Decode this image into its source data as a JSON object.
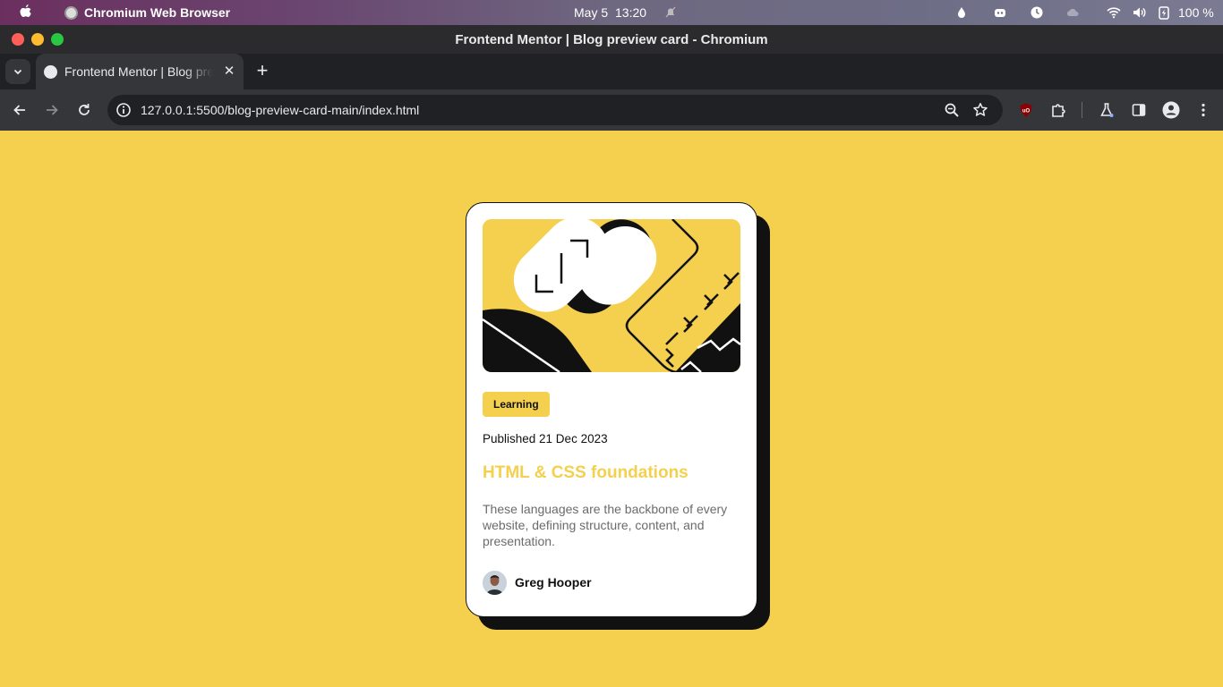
{
  "menubar": {
    "app_name": "Chromium Web Browser",
    "date": "May 5",
    "time": "13:20",
    "battery": "100 %"
  },
  "window": {
    "title": "Frontend Mentor | Blog preview card - Chromium"
  },
  "tabs": [
    {
      "title": "Frontend Mentor | Blog preview card"
    }
  ],
  "toolbar": {
    "url": "127.0.0.1:5500/blog-preview-card-main/index.html"
  },
  "card": {
    "badge": "Learning",
    "published": "Published 21 Dec 2023",
    "title": "HTML & CSS foundations",
    "excerpt": "These languages are the backbone of every website, defining structure, content, and presentation.",
    "author": "Greg Hooper"
  },
  "colors": {
    "page_background": "#f4d04e",
    "accent": "#f4d04e",
    "ink": "#111111",
    "card": "#ffffff"
  }
}
